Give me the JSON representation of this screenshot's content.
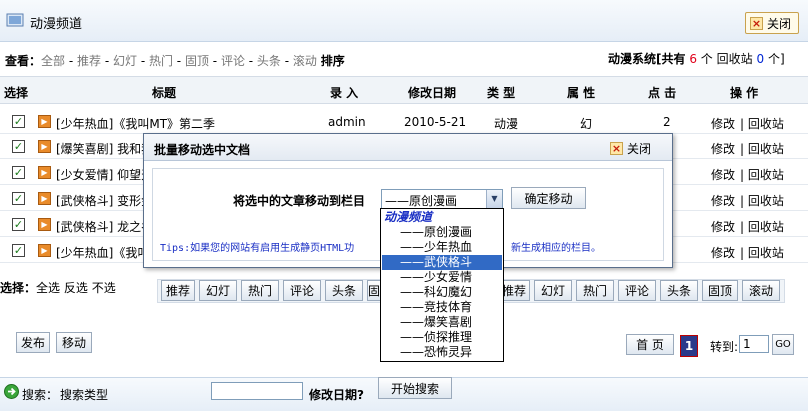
{
  "header": {
    "title": "动漫频道",
    "close_label": "关闭"
  },
  "filter": {
    "label": "查看：",
    "items": [
      "全部",
      "推荐",
      "幻灯",
      "热门",
      "固顶",
      "评论",
      "头条",
      "滚动"
    ],
    "sort_label": "排序"
  },
  "system": {
    "prefix": "动漫系统[共有",
    "count": "6",
    "unit": "个",
    "recycle_label": "回收站",
    "recycle_count": "0",
    "recycle_unit": "个]"
  },
  "table": {
    "headers": [
      "选择",
      "标题",
      "录 入",
      "修改日期",
      "类 型",
      "属 性",
      "点 击",
      "操 作"
    ],
    "rows": [
      {
        "title": "[少年热血]《我叫MT》第二季",
        "author": "admin",
        "date": "2010-5-21",
        "type": "动漫",
        "attr": "幻",
        "clicks": "2",
        "edit": "修改",
        "recycle": "回收站"
      },
      {
        "title": "[爆笑喜剧] 我和我",
        "edit": "修改",
        "recycle": "回收站"
      },
      {
        "title": "[少女爱情] 仰望天",
        "edit": "修改",
        "recycle": "回收站"
      },
      {
        "title": "[武侠格斗] 变形金",
        "edit": "修改",
        "recycle": "回收站"
      },
      {
        "title": "[武侠格斗] 龙之谷",
        "edit": "修改",
        "recycle": "回收站"
      },
      {
        "title": "[少年热血]《我叫",
        "edit": "修改",
        "recycle": "回收站"
      }
    ]
  },
  "selection": {
    "label": "选择：",
    "all": "全选",
    "invert": "反选",
    "none": "不选"
  },
  "action_buttons": [
    "推荐",
    "幻灯",
    "热门",
    "评论",
    "头条",
    "固",
    "推荐",
    "幻灯",
    "热门",
    "评论",
    "头条",
    "固顶",
    "滚动"
  ],
  "bottom": {
    "publish": "发布",
    "move": "移动"
  },
  "pager": {
    "first": "首 页",
    "current": "1",
    "goto_label": "转到:",
    "goto_value": "1",
    "go": "GO"
  },
  "search": {
    "label": "搜索：",
    "type_label": "搜索类型",
    "date_label": "修改日期?",
    "button": "开始搜索"
  },
  "dialog": {
    "title": "批量移动选中文档",
    "close_label": "关闭",
    "prompt": "将选中的文章移动到栏目",
    "selected": "——原创漫画",
    "confirm": "确定移动",
    "tips": "Tips:如果您的网站有启用生成静页HTML功",
    "tips_tail": "新生成相应的栏目。"
  },
  "dropdown": {
    "group": "动漫频道",
    "options": [
      "——原创漫画",
      "——少年热血",
      "——武侠格斗",
      "——少女爱情",
      "——科幻魔幻",
      "——竞技体育",
      "——爆笑喜剧",
      "——侦探推理",
      "——恐怖灵异"
    ],
    "highlighted_index": 2
  },
  "colors": {
    "accent_red": "#e0001a",
    "accent_blue": "#0026d4",
    "highlight": "#316ac5"
  }
}
